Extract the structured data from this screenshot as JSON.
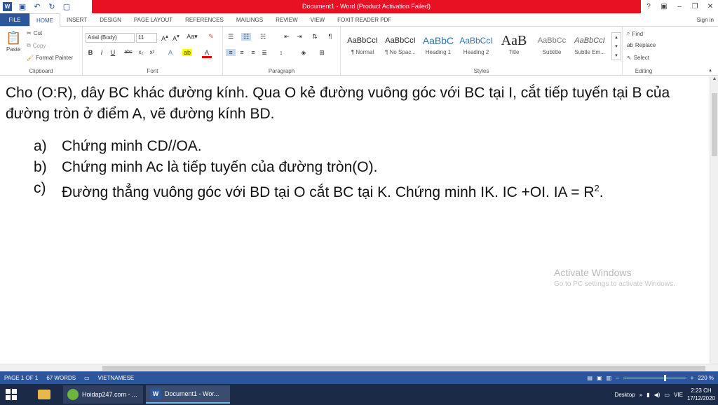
{
  "window": {
    "title": "Document1 - Word (Product Activation Failed)",
    "signin": "Sign in",
    "controls": [
      "?",
      "▣",
      "–",
      "❐",
      "✕"
    ]
  },
  "tabs": [
    "FILE",
    "HOME",
    "INSERT",
    "DESIGN",
    "PAGE LAYOUT",
    "REFERENCES",
    "MAILINGS",
    "REVIEW",
    "VIEW",
    "FOXIT READER PDF"
  ],
  "ribbon": {
    "clipboard": {
      "label": "Clipboard",
      "paste": "Paste",
      "cut": "Cut",
      "copy": "Copy",
      "format_painter": "Format Painter"
    },
    "font": {
      "label": "Font",
      "family": "Arial (Body)",
      "size": "11"
    },
    "paragraph": {
      "label": "Paragraph"
    },
    "styles": {
      "label": "Styles",
      "items": [
        {
          "sample": "AaBbCcI",
          "name": "¶ Normal"
        },
        {
          "sample": "AaBbCcI",
          "name": "¶ No Spac..."
        },
        {
          "sample": "AaBbC",
          "name": "Heading 1"
        },
        {
          "sample": "AaBbCcI",
          "name": "Heading 2"
        },
        {
          "sample": "AaB",
          "name": "Title"
        },
        {
          "sample": "AaBbCc",
          "name": "Subtitle"
        },
        {
          "sample": "AaBbCcI",
          "name": "Subtle Em..."
        }
      ]
    },
    "editing": {
      "label": "Editing",
      "find": "Find",
      "replace": "Replace",
      "select": "Select"
    }
  },
  "document": {
    "paragraph": "Cho (O:R), dây BC khác đường kính. Qua O kẻ đường vuông góc với BC tại I, cắt tiếp tuyến tại B của đường tròn ở điểm A, vẽ đường kính BD.",
    "items": [
      {
        "marker": "a)",
        "text": "Chứng minh CD//OA."
      },
      {
        "marker": "b)",
        "text": "Chứng minh Ac là tiếp tuyến của đường tròn(O)."
      },
      {
        "marker": "c)",
        "text": "Đường thẳng vuông góc với BD tại O cắt BC tại K. Chứng minh IK. IC +OI. IA = R",
        "sup": "2",
        "tail": "."
      }
    ],
    "watermark_title": "Activate Windows",
    "watermark_sub": "Go to PC settings to activate Windows."
  },
  "status": {
    "page": "PAGE 1 OF 1",
    "words": "67 WORDS",
    "language": "VIETNAMESE",
    "zoom": "220 %"
  },
  "taskbar": {
    "items": [
      "Hoidap247.com - ...",
      "Document1 - Wor..."
    ],
    "desktop": "Desktop",
    "lang": "VIE",
    "time": "2:23 CH",
    "date": "17/12/2020"
  }
}
